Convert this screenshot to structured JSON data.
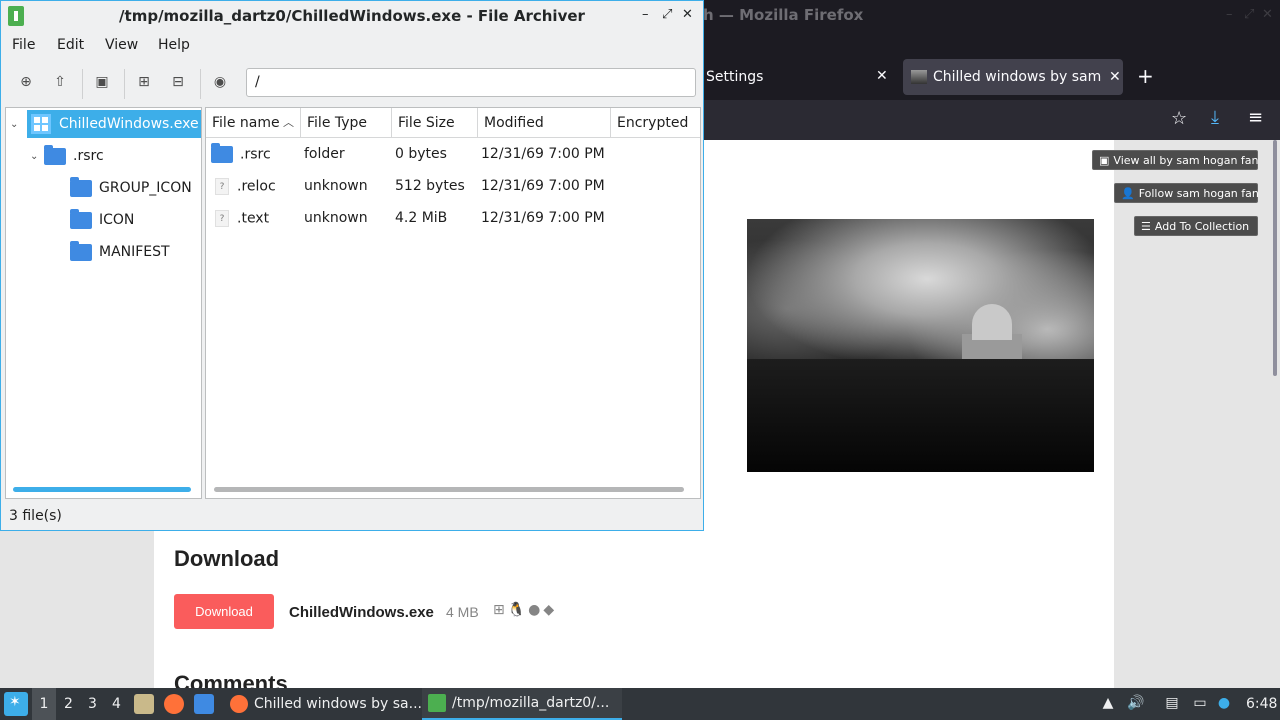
{
  "firefox": {
    "window_title": "h — Mozilla Firefox",
    "tabs": [
      {
        "label": "Settings"
      },
      {
        "label": "Chilled windows by sam h"
      }
    ],
    "sidebar_buttons": {
      "view_all": "View all by sam hogan fan",
      "follow": "Follow sam hogan fan",
      "add_collection": "Add To Collection"
    },
    "page": {
      "download_heading": "Download",
      "download_button": "Download",
      "download_filename": "ChilledWindows.exe",
      "download_size": "4 MB",
      "comments_heading": "Comments"
    }
  },
  "archiver": {
    "title": "/tmp/mozilla_dartz0/ChilledWindows.exe - File Archiver",
    "menu": [
      "File",
      "Edit",
      "View",
      "Help"
    ],
    "path": "/",
    "tree": {
      "root": "ChilledWindows.exe",
      "child": ".rsrc",
      "grandchildren": [
        "GROUP_ICON",
        "ICON",
        "MANIFEST"
      ]
    },
    "columns": [
      "File name",
      "File Type",
      "File Size",
      "Modified",
      "Encrypted"
    ],
    "rows": [
      {
        "name": ".rsrc",
        "type": "folder",
        "size": "0 bytes",
        "modified": "12/31/69 7:00 PM",
        "icon": "folder-icon"
      },
      {
        "name": ".reloc",
        "type": "unknown",
        "size": "512 bytes",
        "modified": "12/31/69 7:00 PM",
        "icon": "unknown-file-icon"
      },
      {
        "name": ".text",
        "type": "unknown",
        "size": "4.2 MiB",
        "modified": "12/31/69 7:00 PM",
        "icon": "unknown-file-icon"
      }
    ],
    "status": "3 file(s)"
  },
  "taskbar": {
    "workspaces": [
      "1",
      "2",
      "3",
      "4"
    ],
    "tasks": [
      {
        "label": "Chilled windows by sa..."
      },
      {
        "label": "/tmp/mozilla_dartz0/..."
      }
    ],
    "clock": "6:48"
  },
  "colors": {
    "accent": "#3daee9",
    "download_button": "#fa5c5c",
    "folder": "#3f8ae2"
  }
}
